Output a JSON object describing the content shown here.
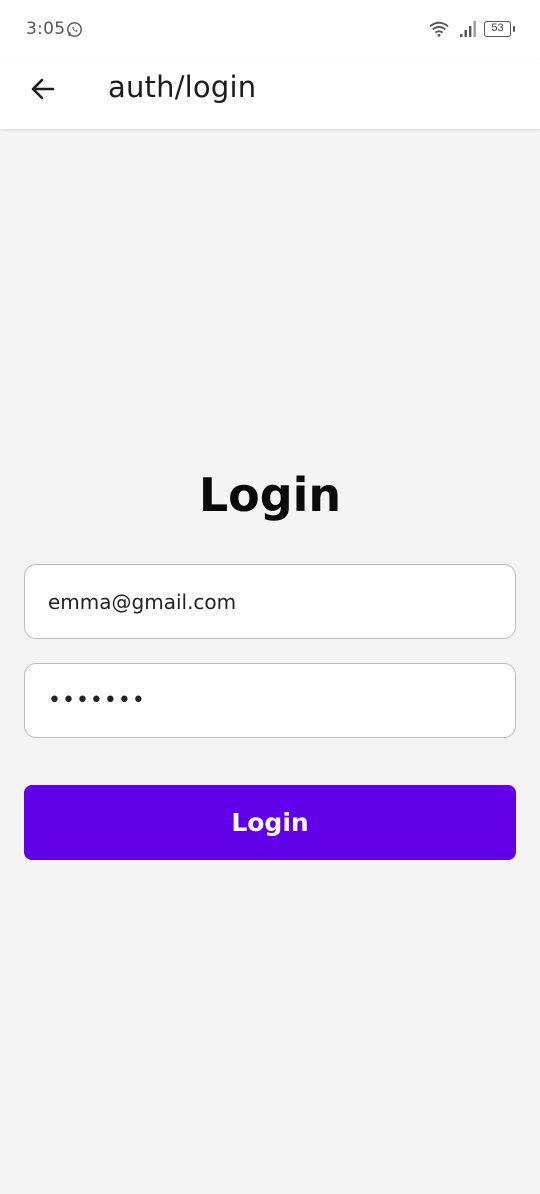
{
  "status_bar": {
    "time": "3:05",
    "battery": "53",
    "icons": [
      "whatsapp-icon",
      "wifi-icon",
      "signal-icon",
      "battery-icon"
    ]
  },
  "app_bar": {
    "title": "auth/login",
    "back_icon": "arrow-left-icon"
  },
  "form": {
    "heading": "Login",
    "email_value": "emma@gmail.com",
    "password_value": "•••••••",
    "submit_label": "Login"
  },
  "colors": {
    "accent": "#6200ea",
    "background": "#f4f4f4",
    "surface": "#ffffff"
  }
}
